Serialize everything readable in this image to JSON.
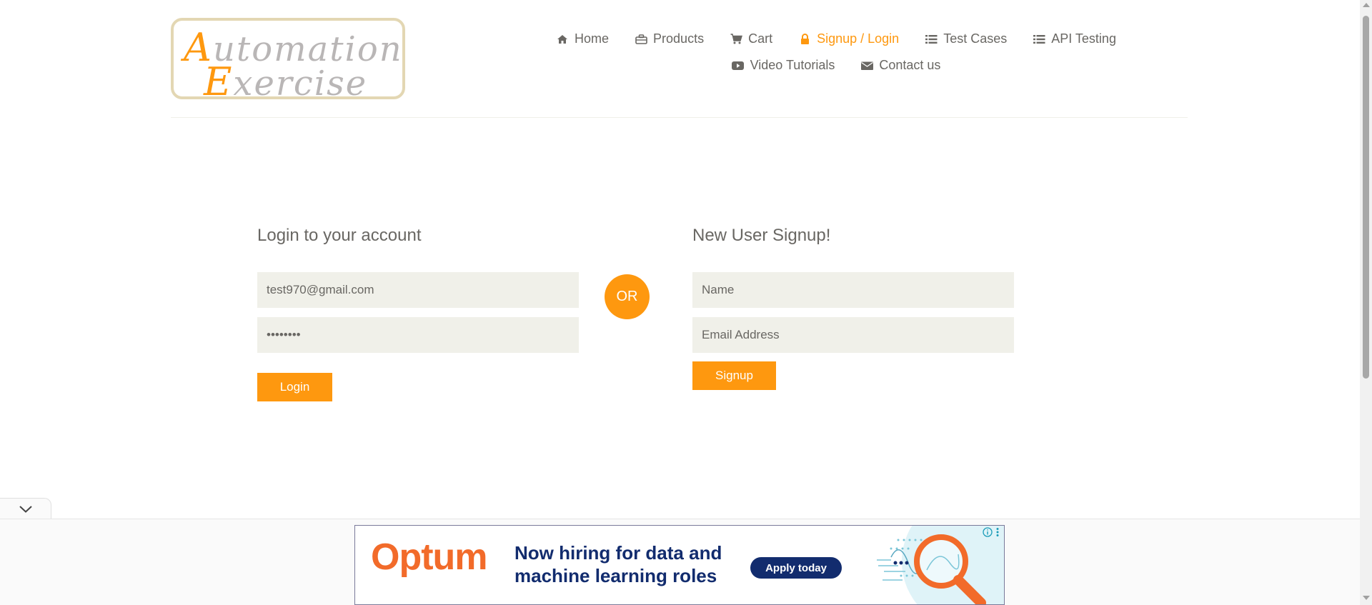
{
  "logo": {
    "line1_cap": "A",
    "line1_rest": "utomation",
    "line2_cap": "E",
    "line2_rest": "xercise"
  },
  "nav": {
    "items": [
      {
        "label": "Home",
        "icon": "home-icon"
      },
      {
        "label": "Products",
        "icon": "briefcase-icon"
      },
      {
        "label": "Cart",
        "icon": "cart-icon"
      },
      {
        "label": "Signup / Login",
        "icon": "lock-icon",
        "active": true
      },
      {
        "label": "Test Cases",
        "icon": "list-icon"
      },
      {
        "label": "API Testing",
        "icon": "list-icon"
      },
      {
        "label": "Video Tutorials",
        "icon": "youtube-icon"
      },
      {
        "label": "Contact us",
        "icon": "envelope-icon"
      }
    ]
  },
  "login": {
    "title": "Login to your account",
    "email_value": "test970@gmail.com",
    "password_value": "pass1234",
    "button": "Login"
  },
  "or_label": "OR",
  "signup": {
    "title": "New User Signup!",
    "name_placeholder": "Name",
    "email_placeholder": "Email Address",
    "button": "Signup"
  },
  "ad": {
    "brand": "Optum",
    "headline": "Now hiring for data and machine learning roles",
    "cta": "Apply today"
  },
  "colors": {
    "accent": "#fe980f",
    "field_bg": "#f0f0e9",
    "text": "#696763",
    "ad_navy": "#122c6e",
    "ad_orange": "#f26b2a"
  }
}
